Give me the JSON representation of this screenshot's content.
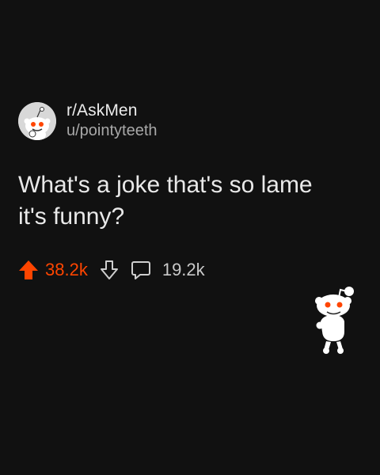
{
  "post": {
    "subreddit": "r/AskMen",
    "username": "u/pointyteeth",
    "title": "What's a joke that's so lame it's funny?",
    "upvotes": "38.2k",
    "comments": "19.2k"
  },
  "icons": {
    "avatar": "snoo-avatar",
    "upvote": "upvote-arrow-icon",
    "downvote": "downvote-arrow-icon",
    "comment": "comment-bubble-icon",
    "mascot": "snoo-mascot-icon"
  },
  "colors": {
    "background": "#111111",
    "accent": "#ff4500",
    "text": "#e9e9e9",
    "muted": "#a8a8a8"
  }
}
